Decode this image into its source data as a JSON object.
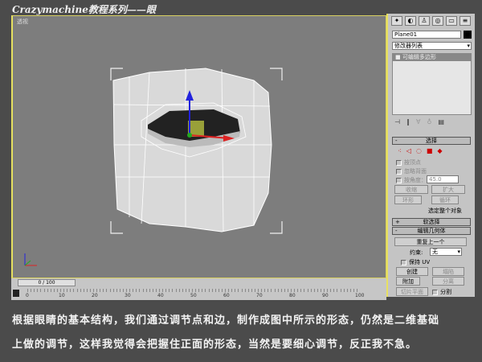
{
  "title": "Crazymachine教程系列——眼",
  "viewport": {
    "label": "透视"
  },
  "panel": {
    "tabs": [
      "create-icon",
      "modify-icon",
      "hierarchy-icon",
      "motion-icon",
      "display-icon",
      "utilities-icon"
    ],
    "object_name": "Plane01",
    "modifier_list": "修改器列表",
    "stack_item": "可编辑多边形",
    "rollout_select": "选择",
    "by_vertex": "按顶点",
    "ignore_backface": "忽略背面",
    "by_angle": "按角度：",
    "angle_value": "45.0",
    "shrink": "收缩",
    "grow": "扩大",
    "ring": "环形",
    "loop": "循环",
    "select_whole": "选定整个对象",
    "soft_select": "软选择",
    "edit_geometry": "编辑几何体",
    "repeat_last": "重复上一个",
    "constraint_label": "约束:",
    "constraint_value": "无",
    "preserve_uv": "保持 UV",
    "create": "创建",
    "collapse": "塌陷",
    "attach": "附加",
    "detach": "分离",
    "slice_plane": "切片平面",
    "split": "分割",
    "plus": "+",
    "minus": "-"
  },
  "timeline": {
    "frame": "0 / 100",
    "ticks": [
      "0",
      "10",
      "20",
      "30",
      "40",
      "50",
      "60",
      "70",
      "80",
      "90",
      "100"
    ]
  },
  "caption": [
    "根据眼睛的基本结构，我们通过调节点和边，制作成图中所示的形态，仍然是二维基础",
    "上做的调节，这样我觉得会把握住正面的形态，当然是要细心调节，反正我不急。"
  ]
}
